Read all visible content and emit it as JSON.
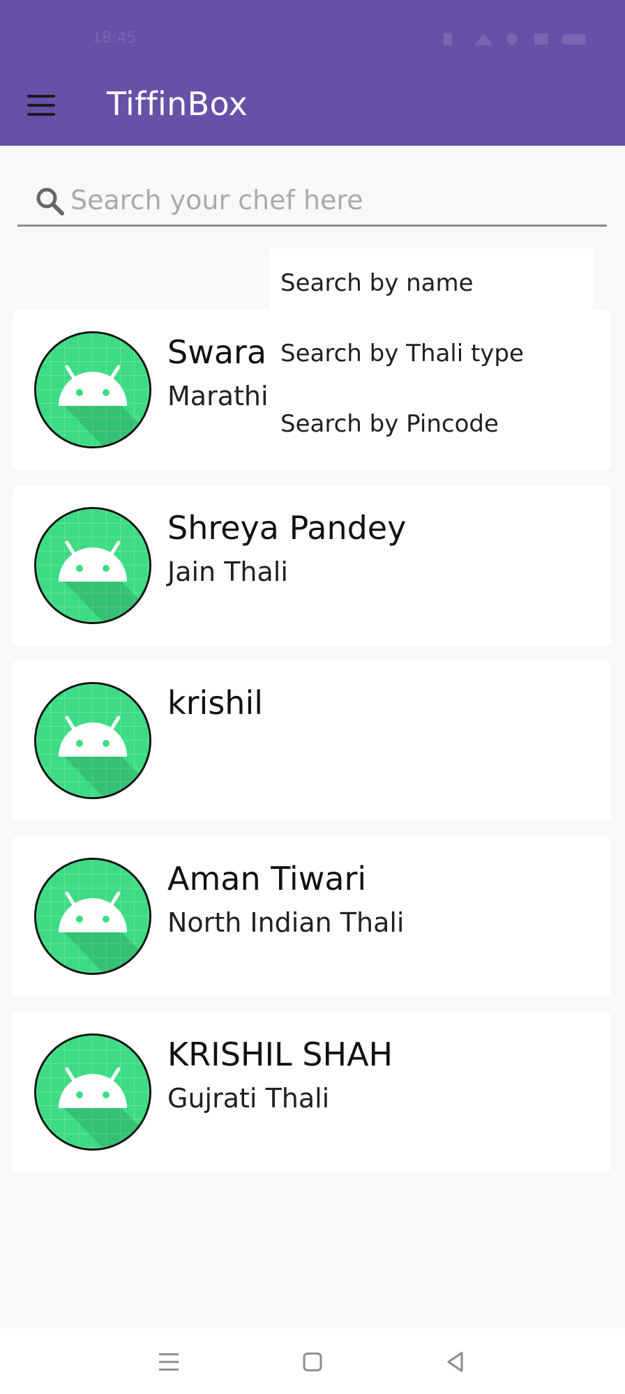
{
  "status_bar": {
    "time": "18:45"
  },
  "app_bar": {
    "menu_icon": "hamburger-menu-icon",
    "title": "TiffinBox",
    "color": "#6650a8"
  },
  "search": {
    "icon": "search-icon",
    "placeholder": "Search your chef here",
    "value": ""
  },
  "search_menu": {
    "items": [
      {
        "label": "Search by name"
      },
      {
        "label": "Search by Thali type"
      },
      {
        "label": "Search by Pincode"
      }
    ]
  },
  "chefs": [
    {
      "name": "Swaral",
      "thali": "Marathi",
      "avatar_icon": "android-avatar-icon"
    },
    {
      "name": "Shreya Pandey",
      "thali": "Jain Thali",
      "avatar_icon": "android-avatar-icon"
    },
    {
      "name": "krishil",
      "thali": "",
      "avatar_icon": "android-avatar-icon"
    },
    {
      "name": "Aman Tiwari",
      "thali": "North Indian Thali",
      "avatar_icon": "android-avatar-icon"
    },
    {
      "name": "KRISHIL SHAH",
      "thali": "Gujrati Thali",
      "avatar_icon": "android-avatar-icon"
    }
  ],
  "nav_bar": {
    "icons": [
      "recent-apps-icon",
      "home-icon",
      "back-icon"
    ]
  },
  "colors": {
    "accent": "#6650a8",
    "avatar": "#3ddc84",
    "background": "#f7f8f8"
  }
}
